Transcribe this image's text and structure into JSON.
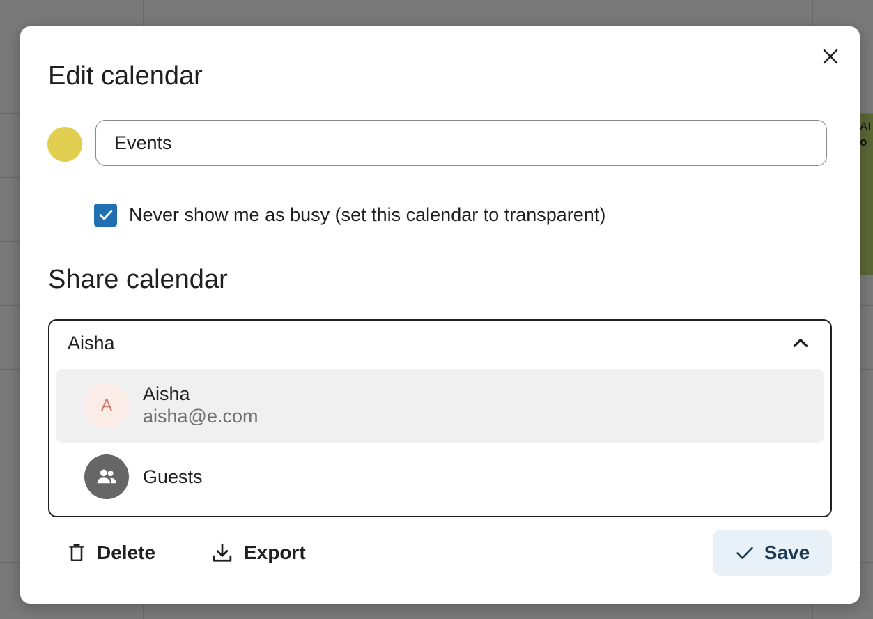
{
  "backdrop": {
    "event_line1": "AI",
    "event_line2": "o"
  },
  "dialog": {
    "title": "Edit calendar",
    "close_icon": "close-icon",
    "calendar_color": "#e2cf51",
    "calendar_name": "Events",
    "busy_checkbox": {
      "checked": true,
      "label": "Never show me as busy (set this calendar to transparent)"
    },
    "share": {
      "title": "Share calendar",
      "input_value": "Aisha",
      "toggle_icon": "chevron-up-icon",
      "options": [
        {
          "avatar_letter": "A",
          "name": "Aisha",
          "email": "aisha@e.com",
          "highlighted": true
        },
        {
          "avatar_icon": "group-icon",
          "name": "Guests",
          "highlighted": false
        }
      ]
    },
    "footer": {
      "delete_label": "Delete",
      "delete_icon": "trash-icon",
      "export_label": "Export",
      "export_icon": "download-icon",
      "save_label": "Save",
      "save_icon": "check-icon"
    }
  },
  "colors": {
    "accent": "#1f6fb2",
    "save_bg": "#e8f1f8",
    "save_text": "#1b3a52",
    "option_highlight": "#f0f0f0"
  }
}
